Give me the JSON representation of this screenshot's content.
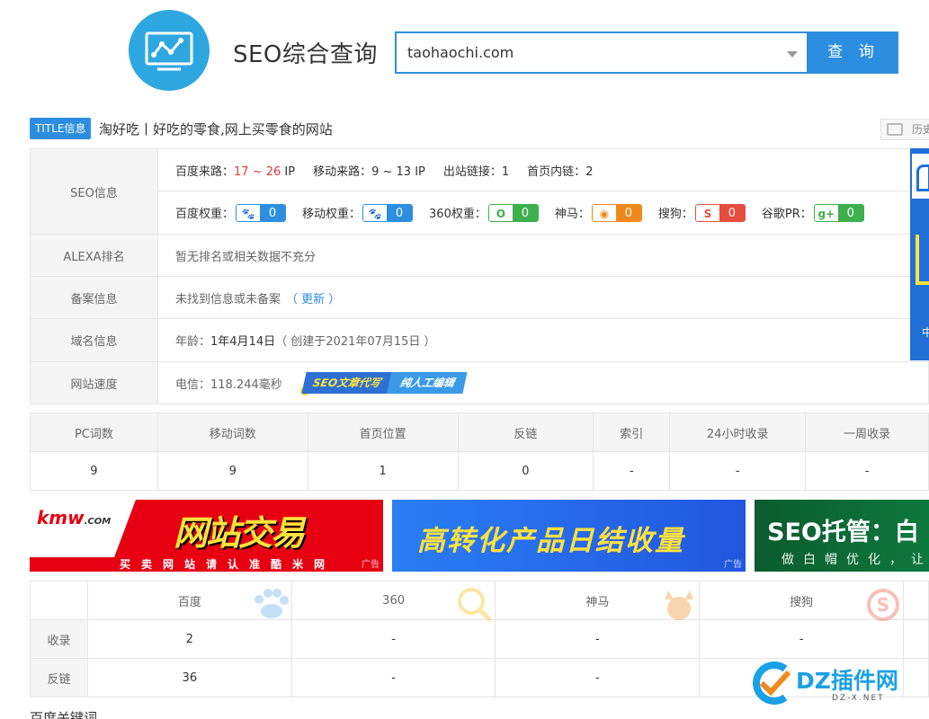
{
  "header": {
    "site_title": "SEO综合查询",
    "search_value": "taohaochi.com",
    "search_button": "查 询"
  },
  "title_row": {
    "badge": "TITLE信息",
    "text": "淘好吃丨好吃的零食,网上买零食的网站",
    "history": "历史"
  },
  "seo_info": {
    "label": "SEO信息",
    "baidu_traffic_label": "百度来路：",
    "baidu_traffic_value": "17 ~ 26",
    "baidu_traffic_unit": " IP",
    "mobile_traffic_label": "移动来路：",
    "mobile_traffic_value": "9 ~ 13 IP",
    "outbound_label": "出站链接：",
    "outbound_value": "1",
    "home_internal_label": "首页内链：",
    "home_internal_value": "2",
    "weights": [
      {
        "label": "百度权重：",
        "icon": "paw-icon",
        "value": "0",
        "color": "#2d8ee0"
      },
      {
        "label": "移动权重：",
        "icon": "paw-icon",
        "value": "0",
        "color": "#2d8ee0"
      },
      {
        "label": "360权重：",
        "icon": "360-icon",
        "value": "0",
        "color": "#3daf4d"
      },
      {
        "label": "神马：",
        "icon": "shenma-icon",
        "value": "0",
        "color": "#f0891d"
      },
      {
        "label": "搜狗：",
        "icon": "sogou-icon",
        "value": "0",
        "color": "#e74c3c"
      },
      {
        "label": "谷歌PR：",
        "icon": "google-plus-icon",
        "value": "0",
        "color": "#3daf4d"
      }
    ]
  },
  "alexa": {
    "label": "ALEXA排名",
    "value": "暂无排名或相关数据不充分"
  },
  "beian": {
    "label": "备案信息",
    "value": "未找到信息或未备案",
    "link": "（ 更新 ）"
  },
  "domain": {
    "label": "域名信息",
    "age_label": "年龄：",
    "age_value": "1年4月14日",
    "created": "（ 创建于2021年07月15日 ）"
  },
  "speed": {
    "label": "网站速度",
    "value": "电信：118.244毫秒",
    "promo1": "SEO文章代写",
    "promo2": "纯人工编辑"
  },
  "side_ad": {
    "text": "中"
  },
  "chart_data": {
    "type": "table",
    "tables": [
      {
        "headers": [
          "PC词数",
          "移动词数",
          "首页位置",
          "反链",
          "索引",
          "24小时收录",
          "一周收录"
        ],
        "rows": [
          [
            "9",
            "9",
            "1",
            "0",
            "-",
            "-",
            "-"
          ]
        ]
      },
      {
        "headers": [
          "",
          "百度",
          "360",
          "神马",
          "搜狗"
        ],
        "rows": [
          [
            "收录",
            "2",
            "-",
            "-",
            "-"
          ],
          [
            "反链",
            "36",
            "-",
            "-",
            ""
          ]
        ]
      }
    ]
  },
  "ads": {
    "ad1_brand": "kmw",
    "ad1_brand_suffix": ".COM",
    "ad1_title": "网站交易",
    "ad1_slogan": "买卖网站请认准酷米网",
    "ad2_title": "高转化产品日结收量",
    "ad3_title": "SEO托管：白",
    "ad3_sub": "做白帽优化，让",
    "ad_tag": "广告"
  },
  "bottom": {
    "title": "百度关键词"
  },
  "watermark": {
    "text": "DZ插件网",
    "sub": "DZ-X.NET"
  }
}
